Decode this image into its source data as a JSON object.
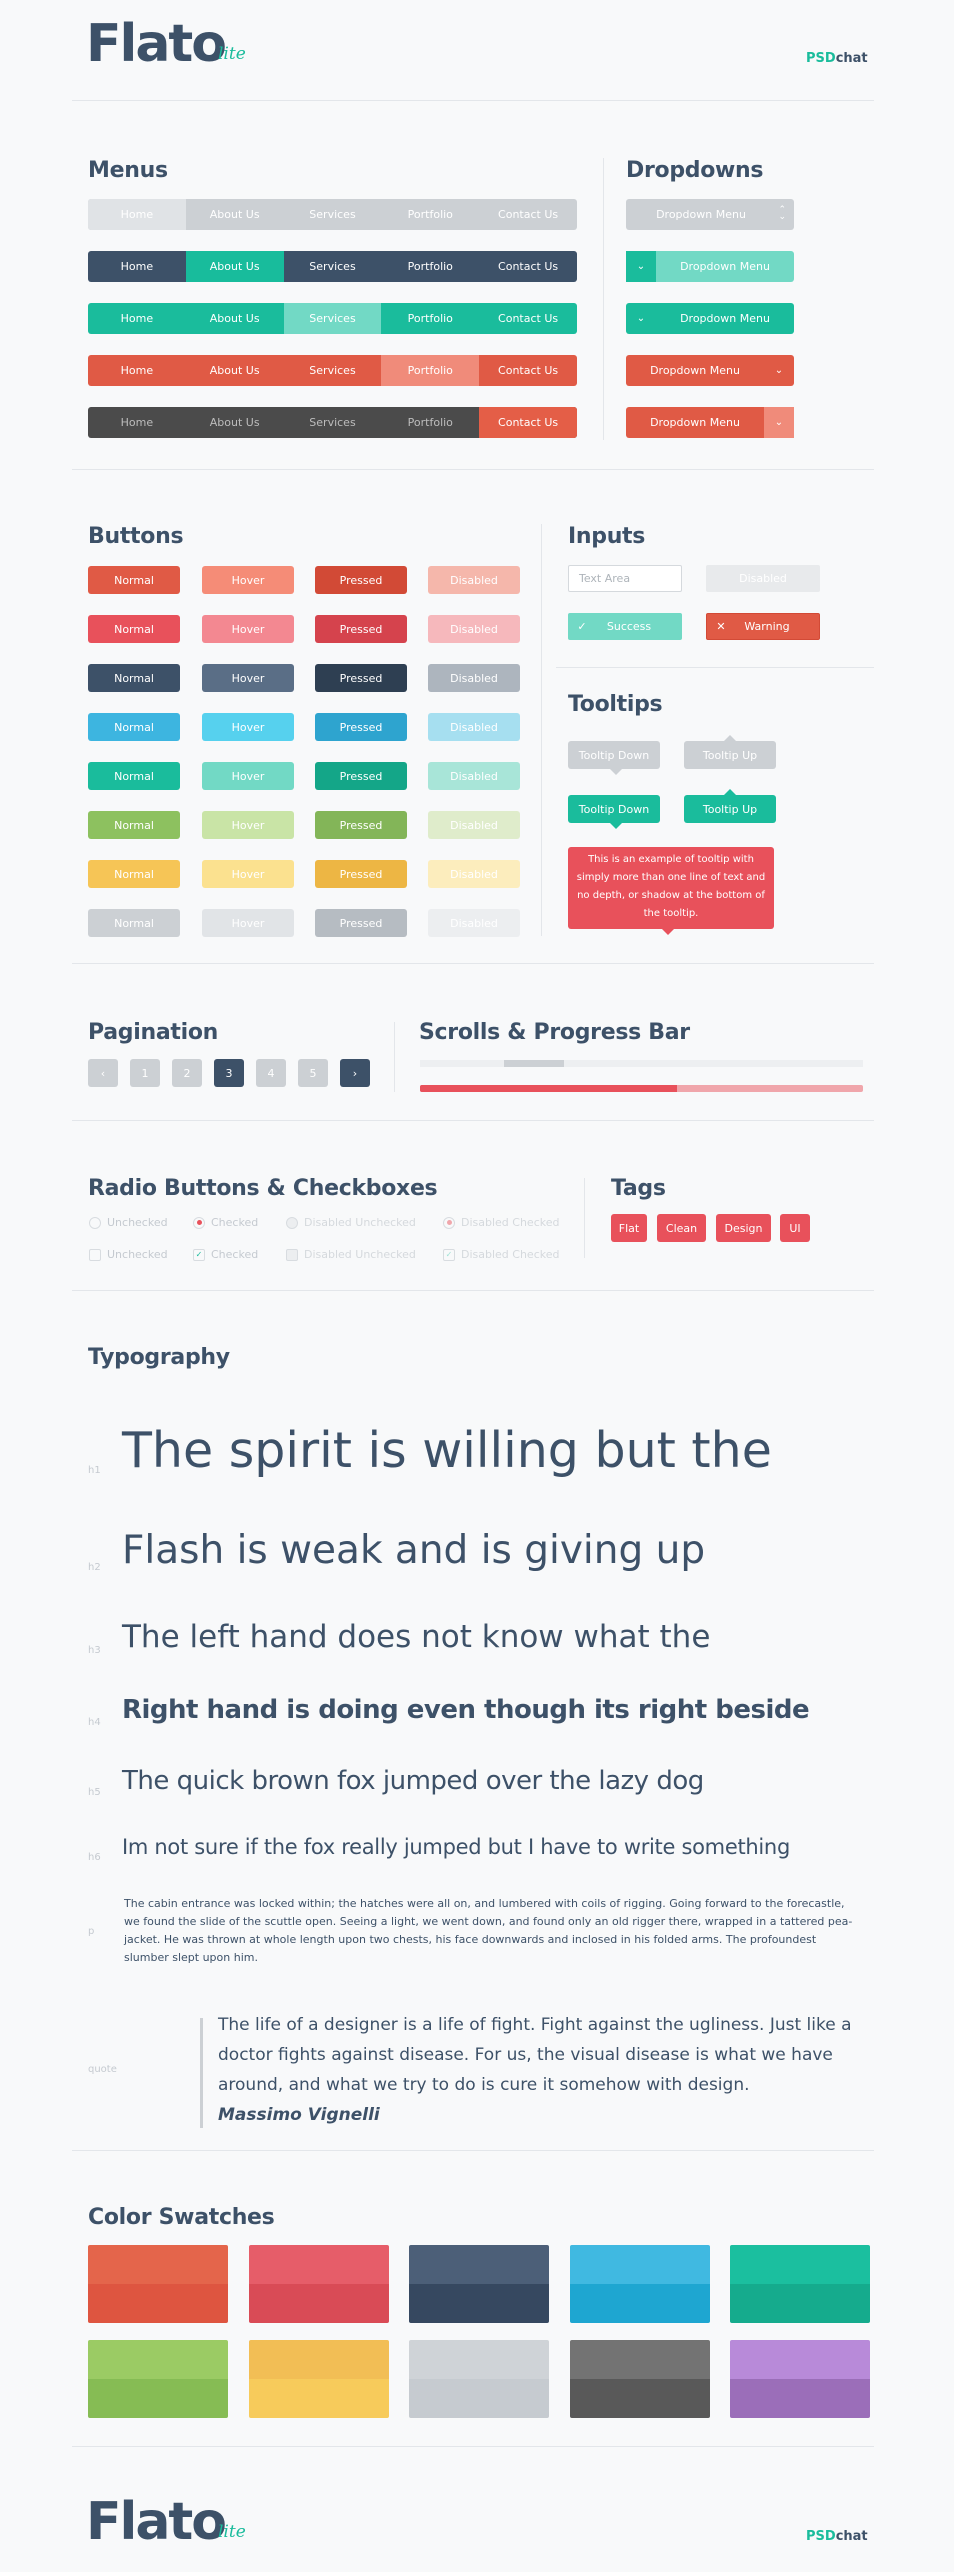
{
  "logo": {
    "main": "Flato",
    "sub": "lite",
    "psd_a": "PSD",
    "psd_b": "chat"
  },
  "sections": {
    "menus": "Menus",
    "dropdowns": "Dropdowns",
    "buttons": "Buttons",
    "inputs": "Inputs",
    "tooltips": "Tooltips",
    "pagination": "Pagination",
    "scrolls": "Scrolls & Progress Bar",
    "radio": "Radio Buttons & Checkboxes",
    "tags": "Tags",
    "typography": "Typography",
    "swatches": "Color Swatches"
  },
  "menu_items": [
    "Home",
    "About Us",
    "Services",
    "Portfolio",
    "Contact Us"
  ],
  "dropdown_label": "Dropdown Menu",
  "button_states": [
    "Normal",
    "Hover",
    "Pressed",
    "Disabled"
  ],
  "inputs": {
    "placeholder": "Text Area",
    "disabled": "Disabled",
    "success": "Success",
    "warning": "Warning"
  },
  "tooltips": {
    "down": "Tooltip Down",
    "up": "Tooltip Up",
    "long": "This is an example of tooltip with simply more than one line of text and no depth, or shadow at the bottom of the tooltip."
  },
  "pagination": {
    "prev": "‹",
    "next": "›",
    "pages": [
      "1",
      "2",
      "3",
      "4",
      "5"
    ],
    "active": "3"
  },
  "progress": {
    "scroll_value": 0.19,
    "bar_value": 0.58
  },
  "checks": {
    "unchecked": "Unchecked",
    "checked": "Checked",
    "dis_unchecked": "Disabled Unchecked",
    "dis_checked": "Disabled Checked"
  },
  "tags": [
    "Flat",
    "Clean",
    "Design",
    "UI"
  ],
  "typography": {
    "h1_label": "h1",
    "h1": "The spirit is willing but the",
    "h2_label": "h2",
    "h2": "Flash is weak and is giving up",
    "h3_label": "h3",
    "h3": "The left hand does not know what the",
    "h4_label": "h4",
    "h4": "Right hand is doing even though its right beside",
    "h5_label": "h5",
    "h5": "The quick brown fox jumped over the lazy dog",
    "h6_label": "h6",
    "h6": "Im not sure if the fox really jumped but I have to write something",
    "p_label": "p",
    "p": "The cabin entrance was locked within; the hatches were all on, and lumbered with coils of rigging. Going forward to the forecastle, we found the slide of the scuttle open. Seeing a light, we went down, and found only an old rigger there, wrapped in a tattered pea-jacket. He was thrown at whole length upon two chests, his face downwards and inclosed in his folded arms. The profoundest slumber slept upon him.",
    "quote_label": "quote",
    "quote": "The life of a designer is a life of fight. Fight against the ugliness. Just like a doctor fights against disease. For us, the visual disease is what we have around, and what we try to do is cure it somehow with design.",
    "quote_author": "Massimo Vignelli"
  },
  "colors": {
    "accent": "#1abc9c",
    "navy": "#3d5168",
    "red": "#e05a45"
  }
}
